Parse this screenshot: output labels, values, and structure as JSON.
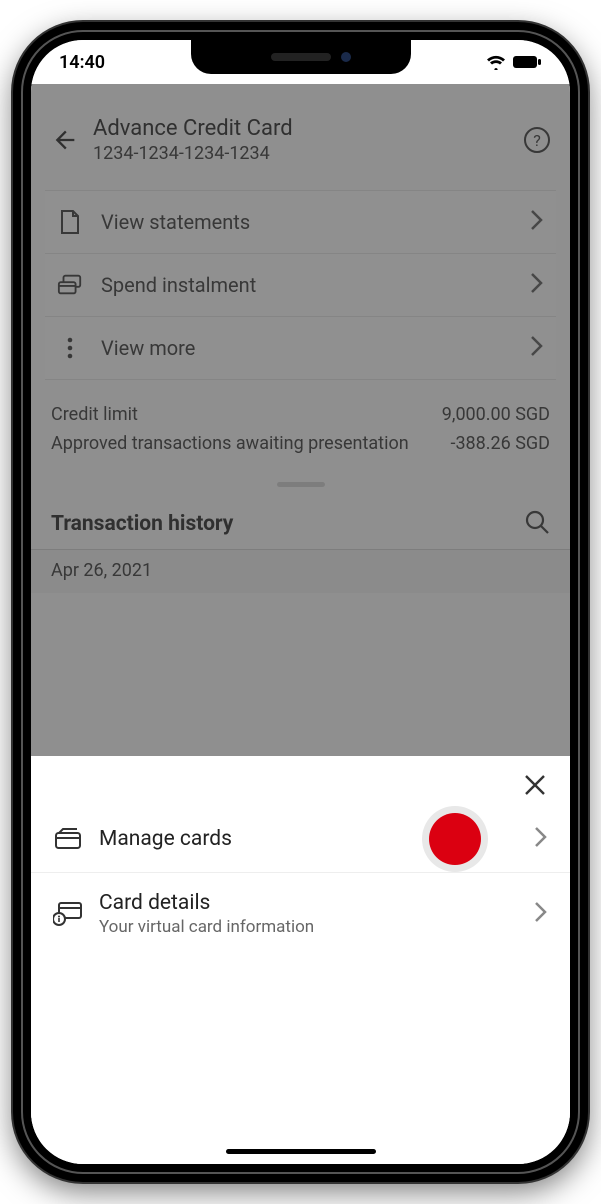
{
  "status_bar": {
    "time": "14:40"
  },
  "header": {
    "title": "Advance Credit Card",
    "card_number": "1234-1234-1234-1234",
    "help_glyph": "?"
  },
  "actions": [
    {
      "label": "View statements"
    },
    {
      "label": "Spend instalment"
    },
    {
      "label": "View more"
    }
  ],
  "balances": [
    {
      "label": "Credit limit",
      "value": "9,000.00 SGD"
    },
    {
      "label": "Approved transactions awaiting presentation",
      "value": "-388.26 SGD"
    }
  ],
  "transactions": {
    "title": "Transaction history",
    "date": "Apr 26, 2021"
  },
  "sheet": {
    "items": [
      {
        "label": "Manage cards",
        "sub": ""
      },
      {
        "label": "Card details",
        "sub": "Your virtual card information"
      }
    ]
  },
  "colors": {
    "accent": "#db0011"
  }
}
